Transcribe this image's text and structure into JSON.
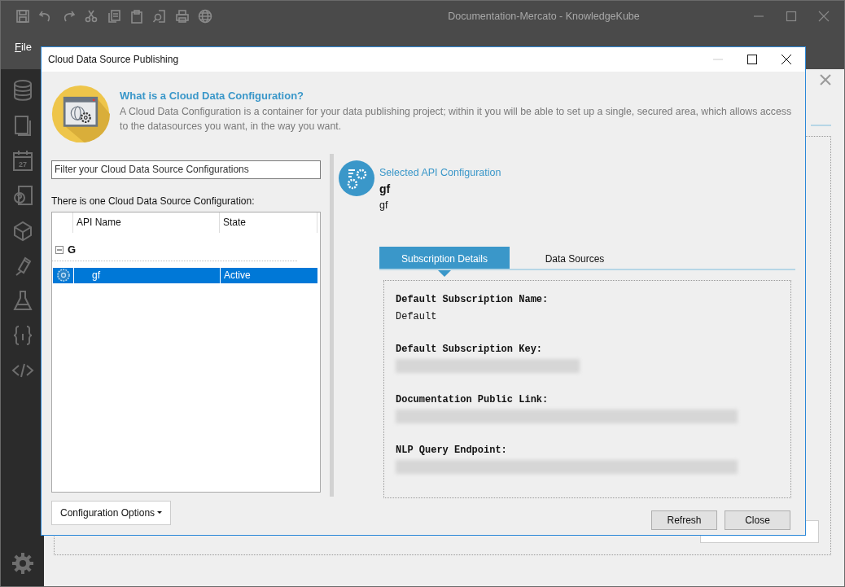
{
  "app": {
    "title": "Documentation-Mercato - KnowledgeKube",
    "menu": [
      {
        "label": "File"
      }
    ]
  },
  "sidebar": {
    "calendar_day": "27"
  },
  "dialog": {
    "title": "Cloud Data Source Publishing",
    "intro": {
      "heading": "What is a Cloud Data Configuration?",
      "text": "A Cloud Data Configuration is a container for your data publishing project; within it you will be able to set up a single, secured area, which allows access to the datasources you want, in the way you want."
    },
    "filter": {
      "placeholder": "Filter your Cloud Data Source Configurations"
    },
    "list_caption": "There is one Cloud Data Source Configuration:",
    "grid": {
      "columns": [
        "API Name",
        "State"
      ],
      "groups": [
        {
          "label": "G",
          "expanded": true,
          "rows": [
            {
              "name": "gf",
              "state": "Active",
              "selected": true
            }
          ]
        }
      ]
    },
    "options_button": "Configuration Options",
    "selected": {
      "caption": "Selected API Configuration",
      "name": "gf",
      "description": "gf"
    },
    "tabs": [
      {
        "label": "Subscription Details",
        "selected": true
      },
      {
        "label": "Data Sources",
        "selected": false
      }
    ],
    "details": [
      {
        "label": "Default Subscription Name:",
        "kind": "text",
        "value": "Default"
      },
      {
        "label": "Default Subscription Key:",
        "kind": "redacted-short"
      },
      {
        "label": "Documentation Public Link:",
        "kind": "redacted-long"
      },
      {
        "label": "NLP Query Endpoint:",
        "kind": "redacted-long"
      }
    ],
    "buttons": [
      "Refresh",
      "Close"
    ]
  }
}
